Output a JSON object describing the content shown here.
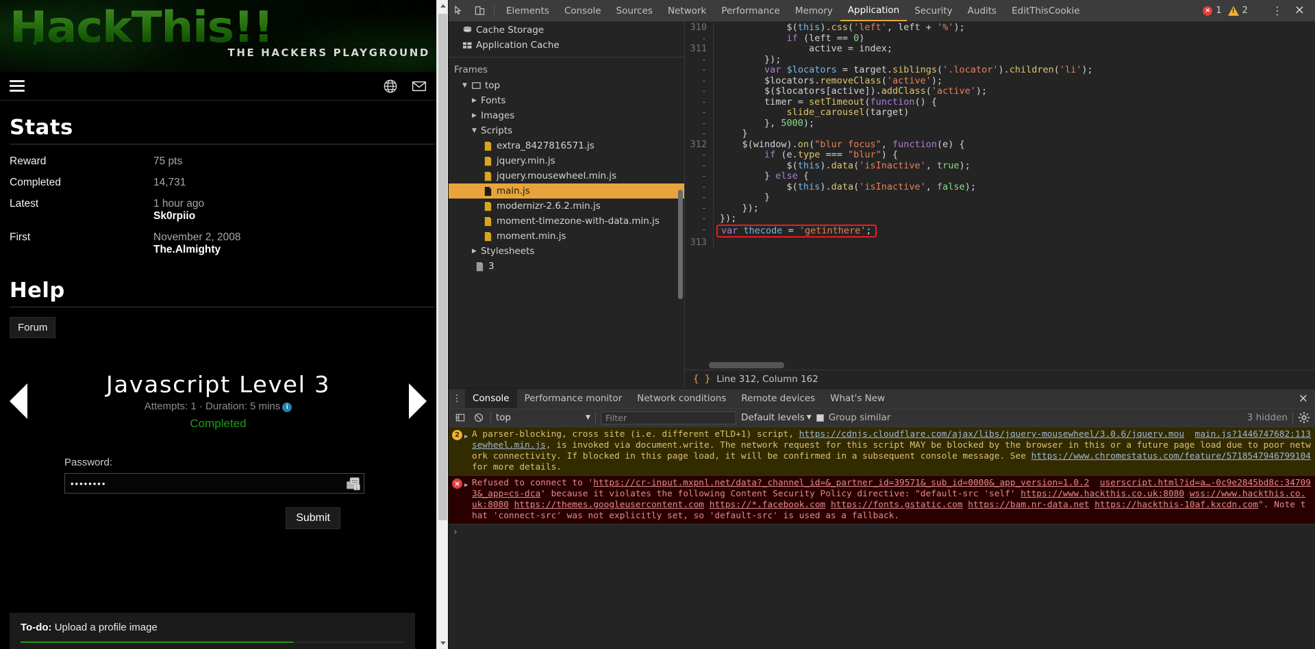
{
  "site": {
    "logo": {
      "main": "HackThis!!",
      "sub": "THE HACKERS PLAYGROUND"
    },
    "nav": {
      "menu_icon": "hamburger-icon",
      "globe_icon": "globe-icon",
      "mail_icon": "envelope-icon"
    },
    "stats": {
      "title": "Stats",
      "rows": [
        {
          "label": "Reward",
          "value": "75 pts",
          "sub": ""
        },
        {
          "label": "Completed",
          "value": "14,731",
          "sub": ""
        },
        {
          "label": "Latest",
          "value": "1 hour ago",
          "sub": "Sk0rpiio"
        },
        {
          "label": "First",
          "value": "November 2, 2008",
          "sub": "The.Almighty"
        }
      ]
    },
    "help": {
      "title": "Help",
      "forum_label": "Forum"
    },
    "level": {
      "title": "Javascript Level 3",
      "meta": "Attempts: 1 · Duration: 5 mins",
      "status": "Completed",
      "prev_icon": "arrow-left-icon",
      "next_icon": "arrow-right-icon",
      "info_icon": "info-icon"
    },
    "form": {
      "password_label": "Password:",
      "password_value": "••••••••",
      "password_placeholder": "",
      "key_icon": "password-manager-icon",
      "submit_label": "Submit"
    },
    "todo": {
      "prefix": "To-do:",
      "text": "Upload a profile image",
      "progress": "71"
    }
  },
  "devtools": {
    "toolbar": {
      "inspect_icon": "inspect-element-icon",
      "device_icon": "device-toolbar-icon",
      "tabs": [
        "Elements",
        "Console",
        "Sources",
        "Network",
        "Performance",
        "Memory",
        "Application",
        "Security",
        "Audits",
        "EditThisCookie"
      ],
      "active_tab": "Application",
      "error_count": "1",
      "warning_count": "2",
      "more_icon": "kebab-menu-icon",
      "close_icon": "close-icon"
    },
    "frames": {
      "storage_items": [
        {
          "label": "Cache Storage",
          "icon": "database-icon"
        },
        {
          "label": "Application Cache",
          "icon": "grid-icon"
        }
      ],
      "heading": "Frames",
      "root": {
        "label": "top",
        "icon": "frame-icon",
        "caret": "down"
      },
      "groups": [
        {
          "label": "Fonts",
          "caret": "right",
          "children": []
        },
        {
          "label": "Images",
          "caret": "right",
          "children": []
        },
        {
          "label": "Scripts",
          "caret": "down",
          "children": [
            {
              "name": "extra_8427816571.js",
              "selected": false
            },
            {
              "name": "jquery.min.js",
              "selected": false
            },
            {
              "name": "jquery.mousewheel.min.js",
              "selected": false
            },
            {
              "name": "main.js",
              "selected": true
            },
            {
              "name": "modernizr-2.6.2.min.js",
              "selected": false
            },
            {
              "name": "moment-timezone-with-data.min.js",
              "selected": false
            },
            {
              "name": "moment.min.js",
              "selected": false
            }
          ]
        },
        {
          "label": "Stylesheets",
          "caret": "right",
          "children": []
        }
      ],
      "doc_item": {
        "label": "3",
        "icon": "document-icon"
      }
    },
    "source": {
      "status_icon": "pretty-print-icon",
      "status_text": "Line 312, Column 162",
      "lines": [
        {
          "num": "310",
          "tokens": [
            {
              "t": "plain",
              "v": "            $("
            },
            {
              "t": "var",
              "v": "this"
            },
            {
              "t": "plain",
              "v": ")."
            },
            {
              "t": "fn",
              "v": "css"
            },
            {
              "t": "plain",
              "v": "("
            },
            {
              "t": "str",
              "v": "'left'"
            },
            {
              "t": "plain",
              "v": ", left + "
            },
            {
              "t": "str",
              "v": "'%'"
            },
            {
              "t": "plain",
              "v": ");"
            }
          ]
        },
        {
          "num": "-",
          "tokens": [
            {
              "t": "plain",
              "v": "            "
            },
            {
              "t": "key",
              "v": "if"
            },
            {
              "t": "plain",
              "v": " (left == "
            },
            {
              "t": "num",
              "v": "0"
            },
            {
              "t": "plain",
              "v": ")"
            }
          ]
        },
        {
          "num": "311",
          "tokens": [
            {
              "t": "plain",
              "v": "                active = index;"
            }
          ]
        },
        {
          "num": "-",
          "tokens": [
            {
              "t": "plain",
              "v": "        });"
            }
          ]
        },
        {
          "num": "-",
          "tokens": [
            {
              "t": "plain",
              "v": "        "
            },
            {
              "t": "key",
              "v": "var"
            },
            {
              "t": "plain",
              "v": " "
            },
            {
              "t": "var",
              "v": "$locators"
            },
            {
              "t": "plain",
              "v": " = target."
            },
            {
              "t": "fn",
              "v": "siblings"
            },
            {
              "t": "plain",
              "v": "("
            },
            {
              "t": "str",
              "v": "'.locator'"
            },
            {
              "t": "plain",
              "v": ")."
            },
            {
              "t": "fn",
              "v": "children"
            },
            {
              "t": "plain",
              "v": "("
            },
            {
              "t": "str",
              "v": "'li'"
            },
            {
              "t": "plain",
              "v": ");"
            }
          ]
        },
        {
          "num": "-",
          "tokens": [
            {
              "t": "plain",
              "v": "        $locators."
            },
            {
              "t": "fn",
              "v": "removeClass"
            },
            {
              "t": "plain",
              "v": "("
            },
            {
              "t": "str",
              "v": "'active'"
            },
            {
              "t": "plain",
              "v": ");"
            }
          ]
        },
        {
          "num": "-",
          "tokens": [
            {
              "t": "plain",
              "v": "        $($locators[active])."
            },
            {
              "t": "fn",
              "v": "addClass"
            },
            {
              "t": "plain",
              "v": "("
            },
            {
              "t": "str",
              "v": "'active'"
            },
            {
              "t": "plain",
              "v": ");"
            }
          ]
        },
        {
          "num": "-",
          "tokens": [
            {
              "t": "plain",
              "v": "        timer = "
            },
            {
              "t": "fn",
              "v": "setTimeout"
            },
            {
              "t": "plain",
              "v": "("
            },
            {
              "t": "key",
              "v": "function"
            },
            {
              "t": "plain",
              "v": "() {"
            }
          ]
        },
        {
          "num": "-",
          "tokens": [
            {
              "t": "plain",
              "v": "            "
            },
            {
              "t": "fn",
              "v": "slide_carousel"
            },
            {
              "t": "plain",
              "v": "(target)"
            }
          ]
        },
        {
          "num": "-",
          "tokens": [
            {
              "t": "plain",
              "v": "        }, "
            },
            {
              "t": "num",
              "v": "5000"
            },
            {
              "t": "plain",
              "v": ");"
            }
          ]
        },
        {
          "num": "-",
          "tokens": [
            {
              "t": "plain",
              "v": "    }"
            }
          ]
        },
        {
          "num": "312",
          "tokens": [
            {
              "t": "plain",
              "v": "    $(window)."
            },
            {
              "t": "fn",
              "v": "on"
            },
            {
              "t": "plain",
              "v": "("
            },
            {
              "t": "str",
              "v": "\"blur focus\""
            },
            {
              "t": "plain",
              "v": ", "
            },
            {
              "t": "key",
              "v": "function"
            },
            {
              "t": "plain",
              "v": "(e) {"
            }
          ]
        },
        {
          "num": "-",
          "tokens": [
            {
              "t": "plain",
              "v": "        "
            },
            {
              "t": "key",
              "v": "if"
            },
            {
              "t": "plain",
              "v": " (e."
            },
            {
              "t": "fn",
              "v": "type"
            },
            {
              "t": "plain",
              "v": " === "
            },
            {
              "t": "str",
              "v": "\"blur\""
            },
            {
              "t": "plain",
              "v": ") {"
            }
          ]
        },
        {
          "num": "-",
          "tokens": [
            {
              "t": "plain",
              "v": "            $("
            },
            {
              "t": "var",
              "v": "this"
            },
            {
              "t": "plain",
              "v": ")."
            },
            {
              "t": "fn",
              "v": "data"
            },
            {
              "t": "plain",
              "v": "("
            },
            {
              "t": "str",
              "v": "'isInactive'"
            },
            {
              "t": "plain",
              "v": ", "
            },
            {
              "t": "num",
              "v": "true"
            },
            {
              "t": "plain",
              "v": ");"
            }
          ]
        },
        {
          "num": "-",
          "tokens": [
            {
              "t": "plain",
              "v": "        } "
            },
            {
              "t": "key",
              "v": "else"
            },
            {
              "t": "plain",
              "v": " {"
            }
          ]
        },
        {
          "num": "-",
          "tokens": [
            {
              "t": "plain",
              "v": "            $("
            },
            {
              "t": "var",
              "v": "this"
            },
            {
              "t": "plain",
              "v": ")."
            },
            {
              "t": "fn",
              "v": "data"
            },
            {
              "t": "plain",
              "v": "("
            },
            {
              "t": "str",
              "v": "'isInactive'"
            },
            {
              "t": "plain",
              "v": ", "
            },
            {
              "t": "num",
              "v": "false"
            },
            {
              "t": "plain",
              "v": ");"
            }
          ]
        },
        {
          "num": "-",
          "tokens": [
            {
              "t": "plain",
              "v": "        }"
            }
          ]
        },
        {
          "num": "-",
          "tokens": [
            {
              "t": "plain",
              "v": "    });"
            }
          ]
        },
        {
          "num": "-",
          "tokens": [
            {
              "t": "plain",
              "v": "});"
            }
          ]
        },
        {
          "num": "-",
          "highlight": true,
          "tokens": [
            {
              "t": "key",
              "v": "var"
            },
            {
              "t": "plain",
              "v": " "
            },
            {
              "t": "var",
              "v": "thecode"
            },
            {
              "t": "plain",
              "v": " = "
            },
            {
              "t": "str",
              "v": "'getinthere'"
            },
            {
              "t": "plain",
              "v": ";"
            }
          ]
        },
        {
          "num": "313",
          "tokens": [
            {
              "t": "plain",
              "v": ""
            }
          ]
        }
      ],
      "highlight_color": "#f01b1b"
    },
    "drawer": {
      "tabs": [
        "Console",
        "Performance monitor",
        "Network conditions",
        "Remote devices",
        "What's New"
      ],
      "active_tab": "Console",
      "more_icon": "kebab-menu-icon",
      "close_icon": "close-icon",
      "console_toolbar": {
        "sidebar_icon": "console-sidebar-icon",
        "clear_icon": "clear-console-icon",
        "context": "top",
        "context_caret": "chevron-down-icon",
        "filter_placeholder": "Filter",
        "filter_value": "",
        "levels_label": "Default levels",
        "levels_caret": "chevron-down-icon",
        "group_similar_label": "Group similar",
        "group_similar_checked": true,
        "hidden_count": "3 hidden",
        "settings_icon": "gear-icon"
      },
      "messages": [
        {
          "type": "warning",
          "badge": "2",
          "expand_icon": "triangle-right-icon",
          "source": "main.js?1446747682:113",
          "parts": [
            {
              "k": "t",
              "v": "A parser-blocking, cross site (i.e. different eTLD+1) script, "
            },
            {
              "k": "a",
              "v": "https://cdnjs.cloudflare.com/ajax/libs/jquery-mousewheel/3.0.6/jquery.mousewheel.min.js"
            },
            {
              "k": "t",
              "v": ", is invoked via document.write. The network request for this script MAY be blocked by the browser in this or a future page load due to poor network connectivity. If blocked in this page load, it will be confirmed in a subsequent console message. See "
            },
            {
              "k": "a",
              "v": "https://www.chromestatus.com/feature/5718547946799104"
            },
            {
              "k": "t",
              "v": " for more details."
            }
          ]
        },
        {
          "type": "error",
          "badge": "",
          "expand_icon": "triangle-right-icon",
          "source": "userscript.html?id=a…-0c9e2845bd8c:34709",
          "parts": [
            {
              "k": "t",
              "v": "Refused to connect to '"
            },
            {
              "k": "a",
              "v": "https://cr-input.mxpnl.net/data?_channel_id=&_partner_id=39571&_su"
            },
            {
              "k": "a",
              "v": "b_id=0000&_app_version=1.0.23&_app=cs-dca"
            },
            {
              "k": "t",
              "v": "' because it violates the following Content Security Policy directive: \"default-src 'self' "
            },
            {
              "k": "a",
              "v": "https://www.hackthis.co.uk:8080"
            },
            {
              "k": "t",
              "v": " "
            },
            {
              "k": "a",
              "v": "wss://www.hackthis.co.uk:8080"
            },
            {
              "k": "t",
              "v": " "
            },
            {
              "k": "a",
              "v": "https://themes.googleusercontent.com"
            },
            {
              "k": "t",
              "v": " "
            },
            {
              "k": "a",
              "v": "https://*.facebook.com"
            },
            {
              "k": "t",
              "v": " "
            },
            {
              "k": "a",
              "v": "https://fonts.gstatic.com"
            },
            {
              "k": "t",
              "v": " "
            },
            {
              "k": "a",
              "v": "https://bam.nr-data.net"
            },
            {
              "k": "t",
              "v": " "
            },
            {
              "k": "a",
              "v": "https://hackthis-10af.kxcdn.com"
            },
            {
              "k": "t",
              "v": "\". Note that 'connect-src' was not explicitly set, so 'default-src' is used as a fallback."
            }
          ]
        }
      ],
      "prompt_caret": "›"
    }
  }
}
